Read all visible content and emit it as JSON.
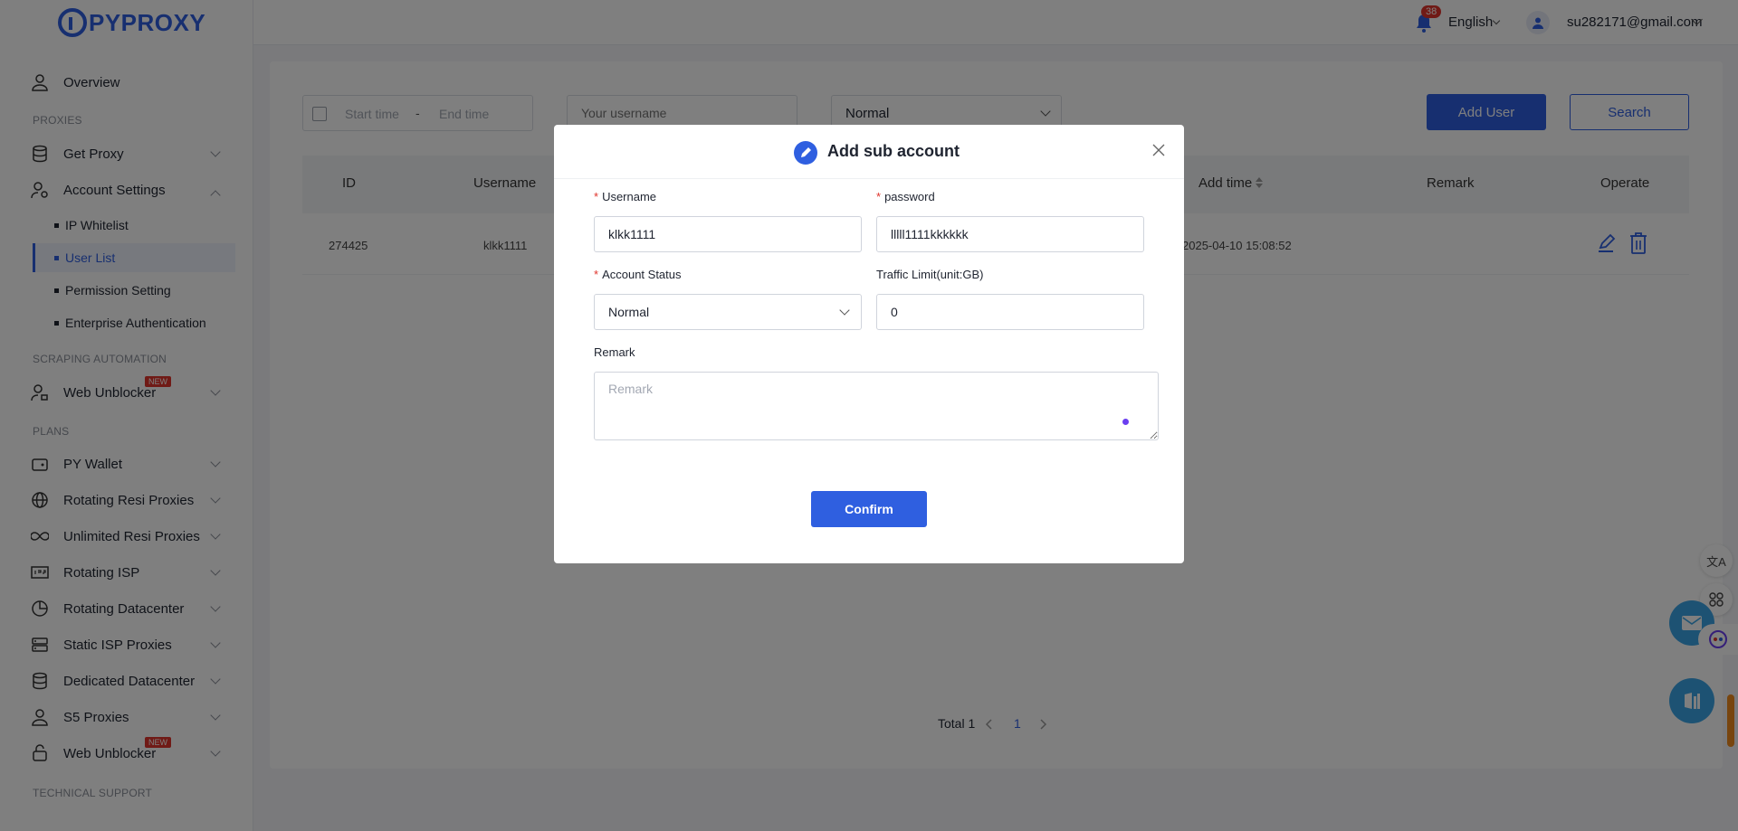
{
  "brand": {
    "logo_text": "PYPROXY"
  },
  "header": {
    "notification_count": "38",
    "language": "English",
    "user_email": "su282171@gmail.com"
  },
  "sidebar": {
    "overview": "Overview",
    "section_proxies": "PROXIES",
    "get_proxy": "Get Proxy",
    "account_settings": "Account Settings",
    "account_sub": [
      "IP Whitelist",
      "User List",
      "Permission Setting",
      "Enterprise Authentication"
    ],
    "section_scraping": "SCRAPING AUTOMATION",
    "web_unblocker": "Web Unblocker",
    "new_badge": "NEW",
    "section_plans": "PLANS",
    "plans": [
      "PY Wallet",
      "Rotating Resi Proxies",
      "Unlimited Resi Proxies",
      "Rotating ISP",
      "Rotating Datacenter",
      "Static ISP Proxies",
      "Dedicated Datacenter",
      "S5 Proxies",
      "Web Unblocker"
    ],
    "section_support": "TECHNICAL SUPPORT"
  },
  "filters": {
    "start_placeholder": "Start time",
    "separator": "-",
    "end_placeholder": "End time",
    "username_placeholder": "Your username",
    "status_value": "Normal",
    "add_user": "Add User",
    "search": "Search"
  },
  "table": {
    "headers": [
      "ID",
      "Username",
      "Add time",
      "Remark",
      "Operate"
    ],
    "rows": [
      {
        "id": "274425",
        "username": "klkk1111",
        "add_time": "2025-04-10 15:08:52",
        "remark": ""
      }
    ]
  },
  "pagination": {
    "total_label": "Total 1",
    "current_page": "1"
  },
  "float_tools": {
    "translate_icon": "文A"
  },
  "modal": {
    "title": "Add sub account",
    "username_label": "Username",
    "username_value": "klkk1111",
    "password_label": "password",
    "password_value": "lllll1111kkkkkk",
    "status_label": "Account Status",
    "status_value": "Normal",
    "traffic_label": "Traffic Limit(unit:GB)",
    "traffic_value": "0",
    "remark_label": "Remark",
    "remark_placeholder": "Remark",
    "confirm": "Confirm"
  },
  "colors": {
    "primary": "#2f5fe0",
    "badge_red": "#e0342c",
    "float_blue": "#3aa4e6"
  }
}
